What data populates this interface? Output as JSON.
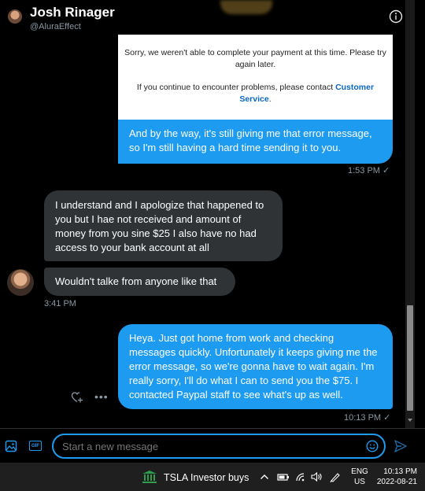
{
  "header": {
    "name": "Josh Rinager",
    "handle": "@AluraEffect"
  },
  "card": {
    "error_text": "Sorry, we weren't able to complete your payment at this time. Please try again later.",
    "help_prefix": "If you continue to encounter problems, please contact ",
    "help_link": "Customer Service",
    "help_suffix": "."
  },
  "messages": [
    {
      "text": "And by the way, it's still giving me that error message, so I'm still having a hard time sending it to you.",
      "time": "1:53 PM ✓"
    },
    {
      "text": "I understand and I apologize that happened to you but I hae not received and amount of money from you sine $25  I also have no had access to your bank account at all"
    },
    {
      "text": "Wouldn't talke from anyone like that",
      "time": "3:41 PM"
    },
    {
      "text": "Heya. Just got home from work and checking messages quickly. Unfortunately it keeps giving me the error message, so we're gonna have to wait again. I'm really sorry, I'll do what I can to send you the $75. I contacted Paypal staff to see what's up as well.",
      "time": "10:13 PM ✓"
    }
  ],
  "actions": {
    "more": "•••"
  },
  "composer": {
    "placeholder": "Start a new message",
    "gif": "GIF"
  },
  "taskbar": {
    "ticker": "TSLA  Investor buys",
    "lang_top": "ENG",
    "lang_bottom": "US",
    "time": "10:13 PM",
    "date": "2022-08-21"
  },
  "colors": {
    "accent": "#1d9bf0",
    "incoming": "#2f3336",
    "background": "#000000"
  },
  "icons": [
    "info-icon",
    "add-reaction-icon",
    "more-icon",
    "image-icon",
    "gif-icon",
    "emoji-icon",
    "send-icon",
    "bank-icon",
    "chevron-up-icon",
    "battery-icon",
    "wifi-icon",
    "volume-icon",
    "pen-icon"
  ]
}
